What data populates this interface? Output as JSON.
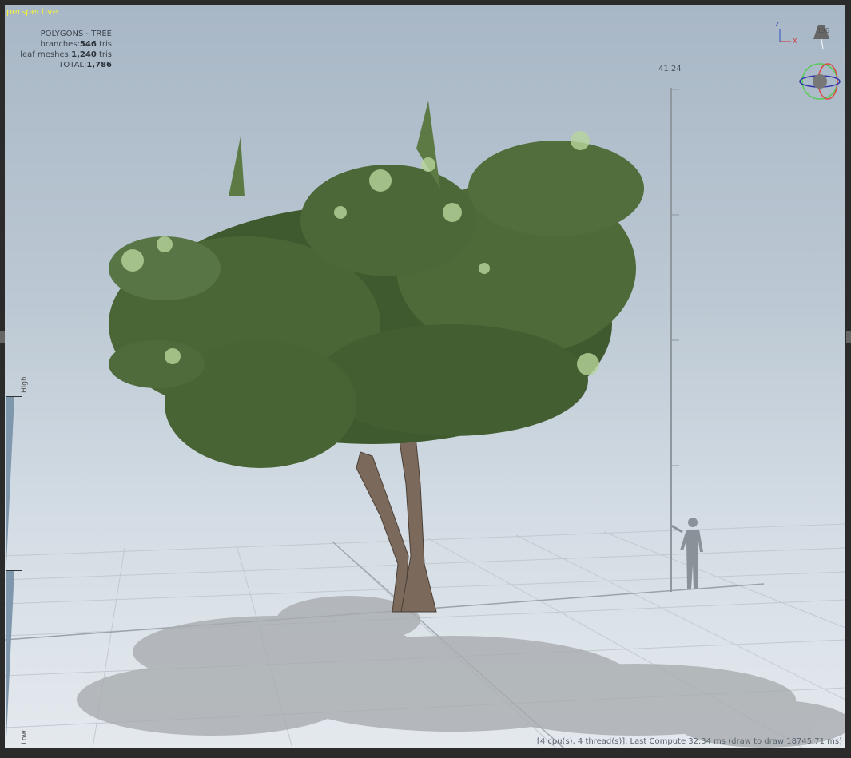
{
  "viewport": {
    "camera_label": "perspective"
  },
  "stats": {
    "title": "POLYGONS - TREE",
    "branches_label": "branches:",
    "branches_value": "546",
    "leaf_label": "leaf meshes:",
    "leaf_value": "1,240",
    "tris_unit": "tris",
    "total_label": "TOTAL:",
    "total_value": "1,786"
  },
  "ruler": {
    "height_value": "41.24"
  },
  "gizmo": {
    "light_value": "136",
    "axis_z": "Z",
    "axis_x": "X"
  },
  "lod": {
    "high": "High",
    "low": "Low"
  },
  "status": {
    "text": "[4 cpu(s), 4 thread(s)], Last Compute 32.34 ms (draw to draw 18745.71 ms)"
  },
  "colors": {
    "leaf_dark": "#3e5a2e",
    "leaf_mid": "#5d7a45",
    "leaf_light": "#b7d59a",
    "bark": "#7b6a5c",
    "accent": "#f0f040"
  }
}
